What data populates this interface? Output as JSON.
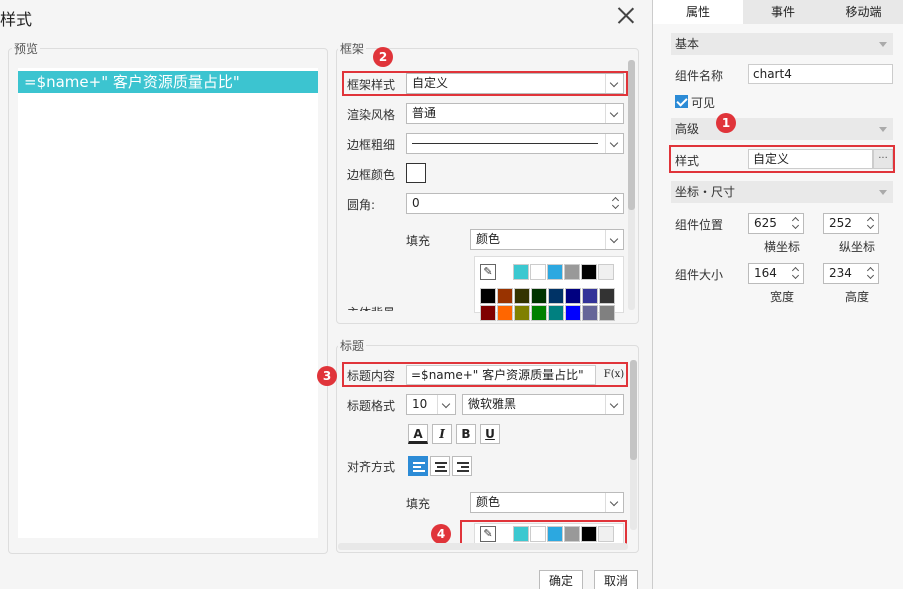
{
  "dialog": {
    "title": "样式",
    "preview_label": "预览",
    "preview_title": "=$name+\" 客户资源质量占比\"",
    "frame_section": "框架",
    "frame_style_label": "框架样式",
    "frame_style_value": "自定义",
    "render_style_label": "渲染风格",
    "render_style_value": "普通",
    "border_width_label": "边框粗细",
    "border_color_label": "边框颜色",
    "radius_label": "圆角:",
    "radius_value": "0",
    "fill_label": "填充",
    "fill_value": "颜色",
    "bg_cut_label": "主体背景",
    "title_section": "标题",
    "title_content_label": "标题内容",
    "title_content_value": "=$name+\" 客户资源质量占比\"",
    "fx_label": "F(x)",
    "title_format_label": "标题格式",
    "font_size_value": "10",
    "font_family_value": "微软雅黑",
    "format_buttons": [
      "A",
      "I",
      "B",
      "U"
    ],
    "align_label": "对齐方式",
    "title_fill_label": "填充",
    "title_fill_value": "颜色",
    "ok_label": "确定",
    "cancel_label": "取消"
  },
  "badges": [
    "1",
    "2",
    "3",
    "4"
  ],
  "palette": {
    "top_row": [
      "#3cc8d0",
      "#ffffff",
      "#2ca8e0",
      "#999999",
      "#000000",
      "#f0f0f0"
    ],
    "grid_row1": [
      "#000000",
      "#993300",
      "#333300",
      "#003300",
      "#003366",
      "#000080",
      "#333399",
      "#333333"
    ],
    "grid_row2": [
      "#800000",
      "#ff6600",
      "#808000",
      "#008000",
      "#008080",
      "#0000ff",
      "#666699",
      "#808080"
    ],
    "title_row": [
      "#3cc8d0",
      "#ffffff",
      "#2ca8e0",
      "#999999",
      "#000000",
      "#f0f0f0"
    ]
  },
  "right_panel": {
    "tabs": [
      "属性",
      "事件",
      "移动端"
    ],
    "basic_section": "基本",
    "component_name_label": "组件名称",
    "component_name_value": "chart4",
    "visible_label": "可见",
    "advanced_section": "高级",
    "style_label": "样式",
    "style_value": "自定义",
    "style_more": "···",
    "coord_section": "坐标・尺寸",
    "position_label": "组件位置",
    "position_x": "625",
    "position_y": "252",
    "x_caption": "横坐标",
    "y_caption": "纵坐标",
    "size_label": "组件大小",
    "width_value": "164",
    "height_value": "234",
    "w_caption": "宽度",
    "h_caption": "高度"
  }
}
